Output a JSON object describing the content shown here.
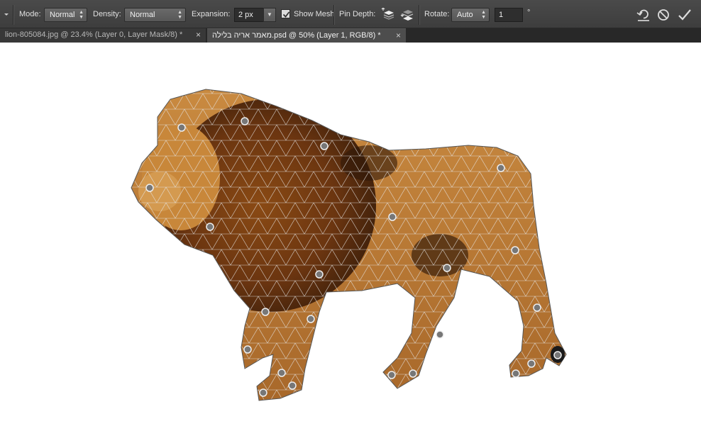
{
  "options_bar": {
    "mode_label": "Mode:",
    "mode_value": "Normal",
    "density_label": "Density:",
    "density_value": "Normal",
    "expansion_label": "Expansion:",
    "expansion_value": "2 px",
    "show_mesh_label": "Show Mesh",
    "show_mesh_checked": true,
    "pin_depth_label": "Pin Depth:",
    "rotate_label": "Rotate:",
    "rotate_mode": "Auto",
    "rotate_angle": "1",
    "degree_symbol": "°"
  },
  "tabs": [
    {
      "label": "lion-805084.jpg @ 23.4% (Layer 0, Layer Mask/8) *",
      "active": false
    },
    {
      "label": "מאמר אריה בלילה.psd @ 50% (Layer 1, RGB/8) *",
      "active": true
    }
  ],
  "icons": [
    "tool-preset-dropdown-icon",
    "pin-depth-front-icon",
    "pin-depth-back-icon",
    "remove-pins-icon",
    "cancel-icon",
    "commit-icon"
  ],
  "colors": {
    "toolbar_bg": "#424242",
    "mesh_line": "#dcdcdc",
    "lion_mane": "#6b3a12",
    "lion_body": "#c98b3c"
  }
}
